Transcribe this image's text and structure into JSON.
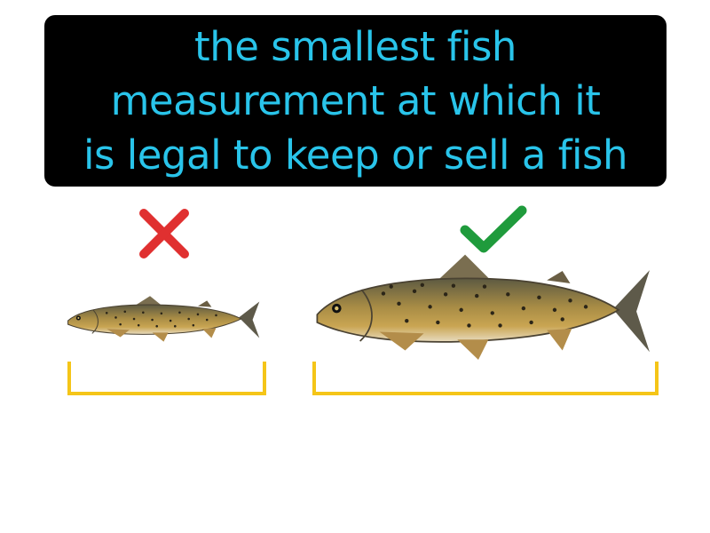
{
  "definition": {
    "lines": [
      "the smallest fish",
      "measurement at which it",
      "is legal to keep or sell a fish"
    ]
  },
  "colors": {
    "background": "#ffffff",
    "box": "#000000",
    "text": "#29c4ea",
    "incorrect": "#e03030",
    "correct": "#1f9b3c",
    "bracket": "#f5c518",
    "fish_body": "#9a8040"
  },
  "examples": [
    {
      "label_icon": "x-mark-icon",
      "status": "incorrect",
      "fish": "small-trout"
    },
    {
      "label_icon": "check-mark-icon",
      "status": "correct",
      "fish": "large-trout"
    }
  ]
}
